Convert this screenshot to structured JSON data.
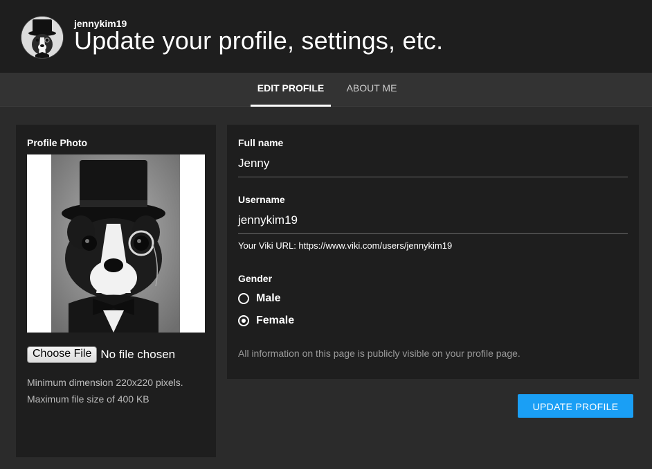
{
  "header": {
    "username": "jennykim19",
    "title": "Update your profile, settings, etc."
  },
  "tabs": [
    {
      "label": "EDIT PROFILE",
      "active": true
    },
    {
      "label": "ABOUT ME",
      "active": false
    }
  ],
  "profile_photo": {
    "label": "Profile Photo",
    "choose_file_label": "Choose File",
    "file_status": "No file chosen",
    "hint_line1": "Minimum dimension 220x220 pixels.",
    "hint_line2": "Maximum file size of 400 KB"
  },
  "form": {
    "full_name_label": "Full name",
    "full_name_value": "Jenny",
    "username_label": "Username",
    "username_value": "jennykim19",
    "viki_url_text": "Your Viki URL: https://www.viki.com/users/jennykim19",
    "gender_label": "Gender",
    "gender_options": [
      {
        "label": "Male",
        "checked": false
      },
      {
        "label": "Female",
        "checked": true
      }
    ],
    "public_note": "All information on this page is publicly visible on your profile page."
  },
  "actions": {
    "update_label": "UPDATE PROFILE"
  },
  "colors": {
    "accent": "#1a9ff5",
    "background": "#2b2b2b",
    "panel": "#1e1e1e"
  }
}
